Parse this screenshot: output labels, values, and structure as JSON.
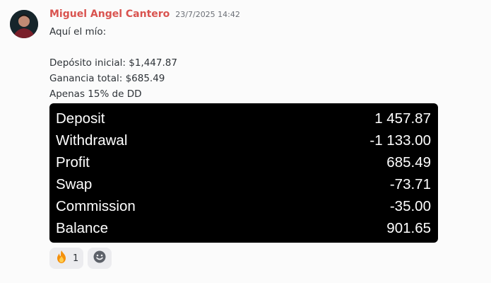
{
  "message": {
    "author": "Miguel Angel Cantero",
    "timestamp": "23/7/2025 14:42",
    "lines": [
      "Aquí el mío:",
      "",
      "Depósito inicial: $1,447.87",
      "Ganancia total: $685.49",
      "Apenas 15% de DD"
    ]
  },
  "attachment": {
    "rows": [
      {
        "label": "Deposit",
        "value": "1 457.87"
      },
      {
        "label": "Withdrawal",
        "value": "-1 133.00"
      },
      {
        "label": "Profit",
        "value": "685.49"
      },
      {
        "label": "Swap",
        "value": "-73.71"
      },
      {
        "label": "Commission",
        "value": "-35.00"
      },
      {
        "label": "Balance",
        "value": "901.65"
      }
    ]
  },
  "reactions": [
    {
      "icon": "fire-icon",
      "count": "1"
    }
  ],
  "add_reaction_icon": "smiley-face-icon",
  "colors": {
    "username": "#d9534f",
    "attachment_bg": "#000000",
    "reaction_bg": "#ececef"
  }
}
